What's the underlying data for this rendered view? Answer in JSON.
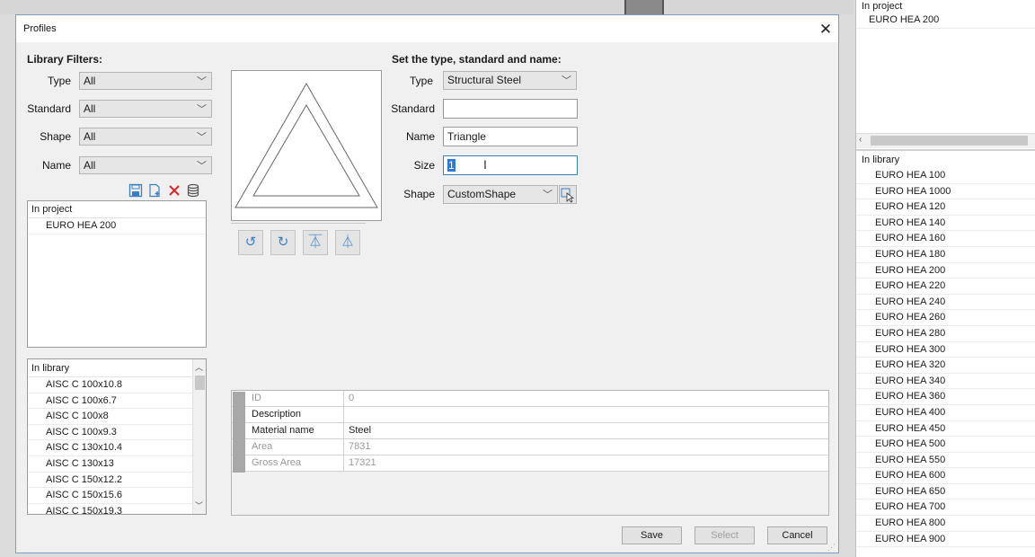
{
  "dialog": {
    "title": "Profiles",
    "close_glyph": "✕"
  },
  "filters": {
    "heading": "Library Filters:",
    "type": {
      "label": "Type",
      "value": "All"
    },
    "standard": {
      "label": "Standard",
      "value": "All"
    },
    "shape": {
      "label": "Shape",
      "value": "All"
    },
    "name": {
      "label": "Name",
      "value": "All"
    }
  },
  "toolbar_icons": [
    "save-icon",
    "new-file-icon",
    "delete-icon",
    "database-icon"
  ],
  "dialog_project_list": {
    "header": "In project",
    "items": [
      "EURO HEA 200"
    ]
  },
  "dialog_library_list": {
    "header": "In library",
    "items": [
      "AISC C 100x10.8",
      "AISC C 100x6.7",
      "AISC C 100x8",
      "AISC C 100x9.3",
      "AISC C 130x10.4",
      "AISC C 130x13",
      "AISC C 150x12.2",
      "AISC C 150x15.6",
      "AISC C 150x19.3"
    ]
  },
  "set_form": {
    "heading": "Set the type, standard and name:",
    "type": {
      "label": "Type",
      "value": "Structural Steel"
    },
    "standard": {
      "label": "Standard",
      "value": ""
    },
    "name": {
      "label": "Name",
      "value": "Triangle"
    },
    "size": {
      "label": "Size",
      "value": "1"
    },
    "shape": {
      "label": "Shape",
      "value": "CustomShape"
    }
  },
  "preview_tools": [
    "rotate-left-icon",
    "rotate-right-icon",
    "mirror-horizontal-icon",
    "mirror-vertical-icon"
  ],
  "properties": [
    {
      "key": "ID",
      "value": "0",
      "muted": true
    },
    {
      "key": "Description",
      "value": "",
      "muted": false
    },
    {
      "key": "Material name",
      "value": "Steel",
      "muted": false
    },
    {
      "key": "Area",
      "value": "7831",
      "muted": true
    },
    {
      "key": "Gross Area",
      "value": "17321",
      "muted": true
    }
  ],
  "buttons": {
    "save": "Save",
    "select": "Select",
    "cancel": "Cancel"
  },
  "side_panel": {
    "project_header": "In project",
    "project_items": [
      "EURO HEA 200"
    ],
    "library_header": "In library",
    "library_items": [
      "EURO HEA 100",
      "EURO HEA 1000",
      "EURO HEA 120",
      "EURO HEA 140",
      "EURO HEA 160",
      "EURO HEA 180",
      "EURO HEA 200",
      "EURO HEA 220",
      "EURO HEA 240",
      "EURO HEA 260",
      "EURO HEA 280",
      "EURO HEA 300",
      "EURO HEA 320",
      "EURO HEA 340",
      "EURO HEA 360",
      "EURO HEA 400",
      "EURO HEA 450",
      "EURO HEA 500",
      "EURO HEA 550",
      "EURO HEA 600",
      "EURO HEA 650",
      "EURO HEA 700",
      "EURO HEA 800",
      "EURO HEA 900"
    ]
  },
  "colors": {
    "accent": "#3c7fb1",
    "selection": "#3078d8",
    "icon_blue": "#3a7fc3",
    "delete_red": "#d9262c"
  }
}
